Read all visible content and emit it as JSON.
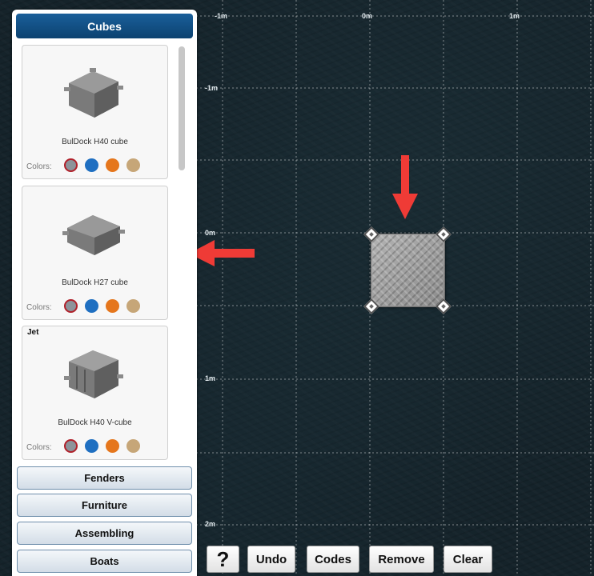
{
  "canvas": {
    "axis_x_labels": [
      "-1m",
      "0m",
      "1m"
    ],
    "axis_y_labels": [
      "-1m",
      "0m",
      "1m",
      "2m"
    ]
  },
  "panel": {
    "header": "Cubes",
    "colors_label": "Colors:",
    "colors": [
      "#8c939a",
      "#1f6fc1",
      "#e5761c",
      "#c6a678"
    ],
    "cards": [
      {
        "badge": "",
        "name": "BulDock H40 cube"
      },
      {
        "badge": "",
        "name": "BulDock H27 cube"
      },
      {
        "badge": "Jet",
        "name": "BulDock H40 V-cube"
      }
    ],
    "categories": [
      "Fenders",
      "Furniture",
      "Assembling",
      "Boats"
    ]
  },
  "toolbar": {
    "help": "?",
    "undo": "Undo",
    "codes": "Codes",
    "remove": "Remove",
    "clear": "Clear"
  },
  "accent": {
    "header_blue": "#0f4c81",
    "arrow_red": "#ef3b36"
  }
}
